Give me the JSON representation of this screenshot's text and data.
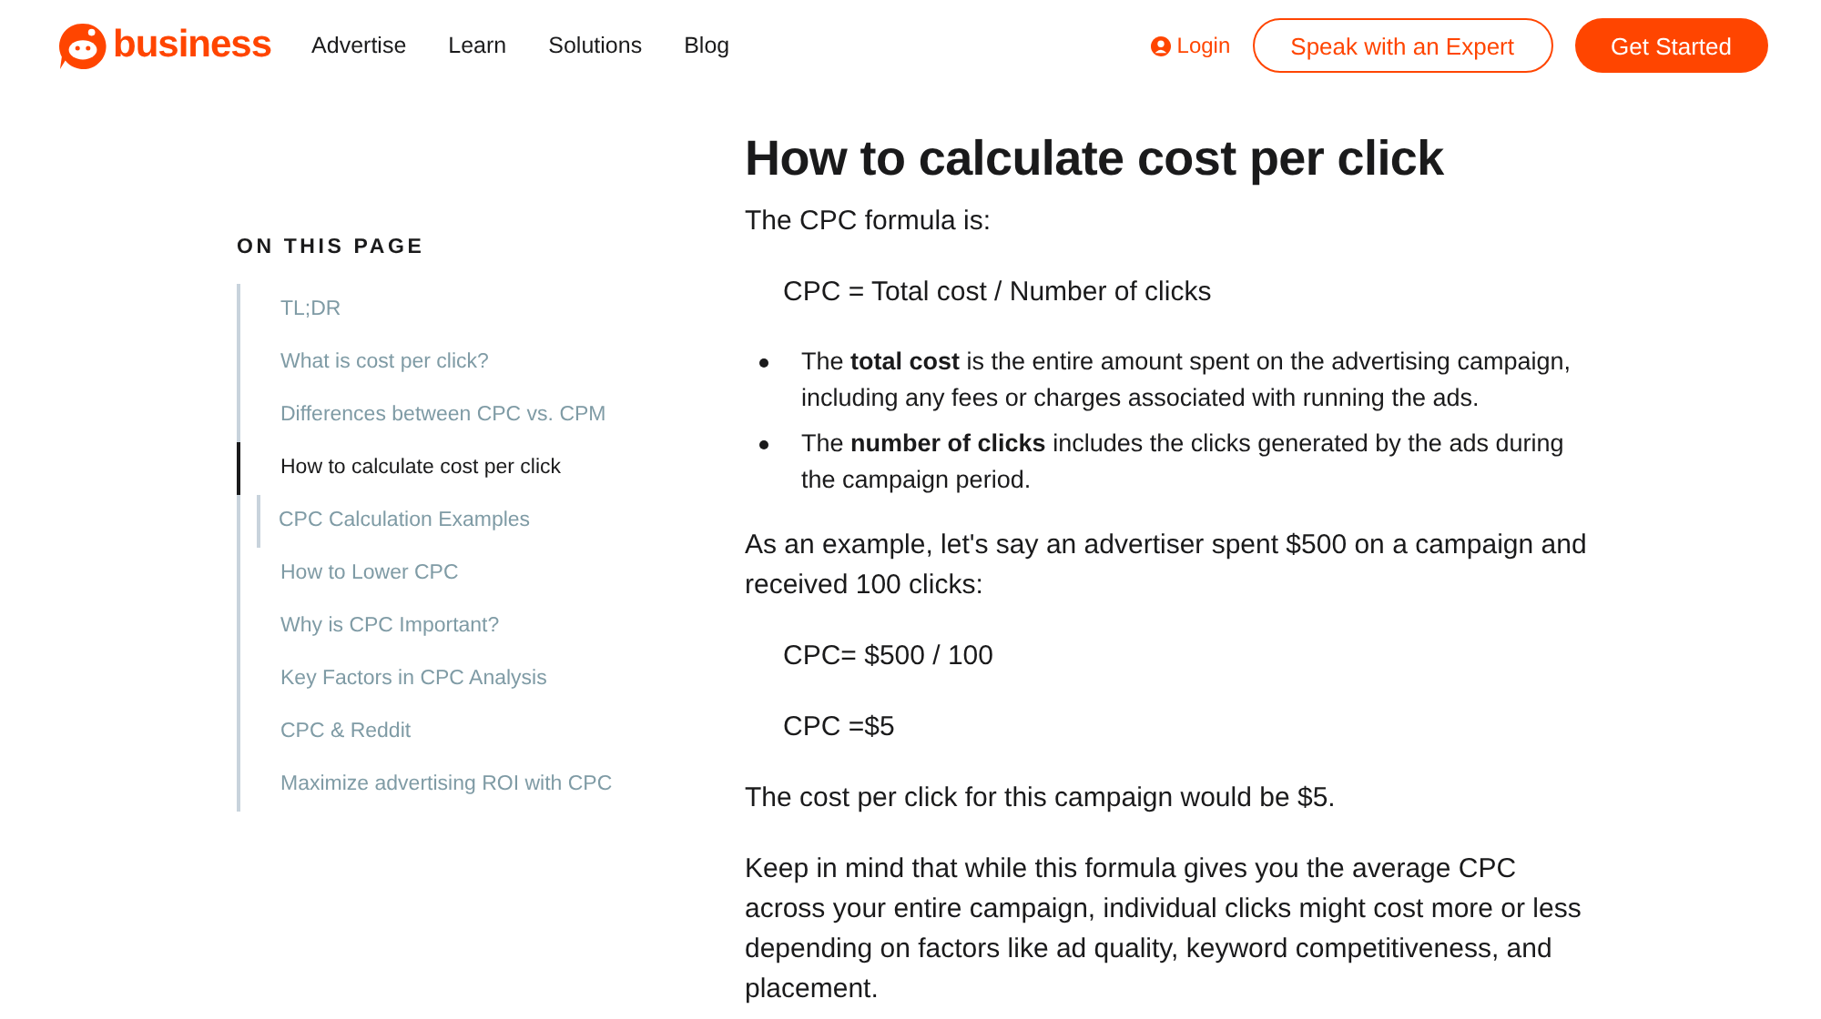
{
  "header": {
    "logo_text": "business",
    "nav": [
      "Advertise",
      "Learn",
      "Solutions",
      "Blog"
    ],
    "login": "Login",
    "secondary_button": "Speak with an Expert",
    "primary_button": "Get Started"
  },
  "toc": {
    "title": "ON THIS PAGE",
    "items": [
      {
        "label": "TL;DR",
        "selected": false
      },
      {
        "label": "What is cost per click?",
        "selected": false
      },
      {
        "label": "Differences between CPC vs. CPM",
        "selected": false
      },
      {
        "label": "How to calculate cost per click",
        "selected": true,
        "children": [
          {
            "label": "CPC Calculation Examples",
            "selected": false
          }
        ]
      },
      {
        "label": "How to Lower CPC",
        "selected": false
      },
      {
        "label": "Why is CPC Important?",
        "selected": false
      },
      {
        "label": "Key Factors in CPC Analysis",
        "selected": false
      },
      {
        "label": "CPC & Reddit",
        "selected": false
      },
      {
        "label": "Maximize advertising ROI with CPC",
        "selected": false
      }
    ]
  },
  "article": {
    "title": "How to calculate cost per click",
    "blocks": [
      {
        "kind": "paragraph",
        "text": "The CPC formula is:"
      },
      {
        "kind": "formula",
        "text": "CPC = Total cost / Number of clicks"
      },
      {
        "kind": "bullets",
        "items": [
          "The **total cost** is the entire amount spent on the advertising campaign, including any fees or charges associated with running the ads.",
          "The **number of clicks** includes the clicks generated by the ads during the campaign period."
        ]
      },
      {
        "kind": "paragraph",
        "text": "As an example, let's say an advertiser spent $500 on a campaign and received 100 clicks:"
      },
      {
        "kind": "formula",
        "text": "CPC= $500 / 100"
      },
      {
        "kind": "formula",
        "text": "CPC =$5"
      },
      {
        "kind": "paragraph",
        "text": "The cost per click for this campaign would be $5."
      },
      {
        "kind": "paragraph",
        "text": "Keep in mind that while this formula gives you the average CPC across your entire campaign, individual clicks might cost more or less depending on factors like ad quality, keyword competitiveness, and placement."
      }
    ]
  }
}
